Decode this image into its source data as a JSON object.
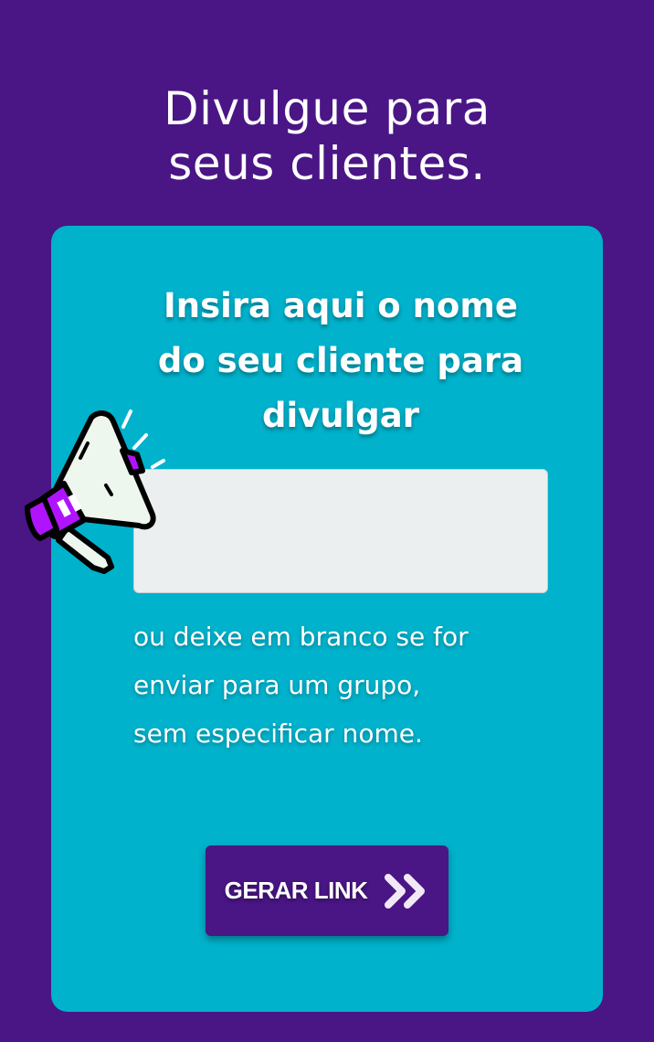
{
  "header": {
    "title_line1": "Divulgue para",
    "title_line2": "seus clientes."
  },
  "card": {
    "heading_line1": "Insira aqui o nome",
    "heading_line2": "do seu cliente para",
    "heading_line3": "divulgar",
    "input": {
      "value": "",
      "placeholder": ""
    },
    "hint_line1": "ou deixe em branco se for",
    "hint_line2": "enviar para um grupo,",
    "hint_line3": "sem especificar nome.",
    "button_label": "GERAR LINK"
  },
  "icons": {
    "decoration": "megaphone-icon",
    "button": "double-chevron-right-icon"
  },
  "colors": {
    "background": "#4a1585",
    "card": "#00b2cc",
    "input": "#eceff0",
    "button": "#4a1585",
    "megaphone_accent": "#b014ff"
  }
}
